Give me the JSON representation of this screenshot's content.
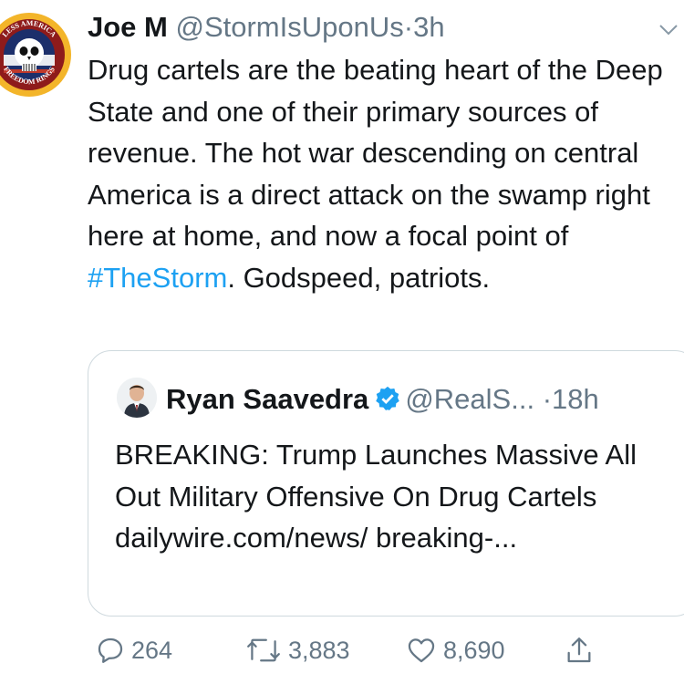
{
  "tweet": {
    "author_name": "Joe M",
    "author_handle": "@StormIsUponUs",
    "separator": "·",
    "time": "3h",
    "avatar_text_top": "LESS AMERICA",
    "avatar_text_bottom": "FREEDOM RINGS",
    "text_before_hashtag": "Drug cartels are the beating heart of the Deep State and one of their primary sources of revenue. The hot war descending on central America is a direct attack on the swamp right here at home, and now a focal point of ",
    "hashtag": "#TheStorm",
    "text_after_hashtag": ". Godspeed, patriots."
  },
  "quote": {
    "author_name": "Ryan Saavedra",
    "author_handle": "@RealS...",
    "separator": "·",
    "time": "18h",
    "verified": true,
    "text": "BREAKING: Trump Launches Massive All Out Military Offensive On Drug Cartels  dailywire.com/news/ breaking-..."
  },
  "actions": {
    "reply_count": "264",
    "retweet_count": "3,883",
    "like_count": "8,690"
  },
  "colors": {
    "link": "#1da1f2",
    "secondary_text": "#657786",
    "border": "#cfd9de",
    "avatar_gold": "#f3b52a"
  },
  "icons": [
    "chevron-down-icon",
    "verified-badge-icon",
    "reply-icon",
    "retweet-icon",
    "like-icon",
    "share-icon"
  ]
}
